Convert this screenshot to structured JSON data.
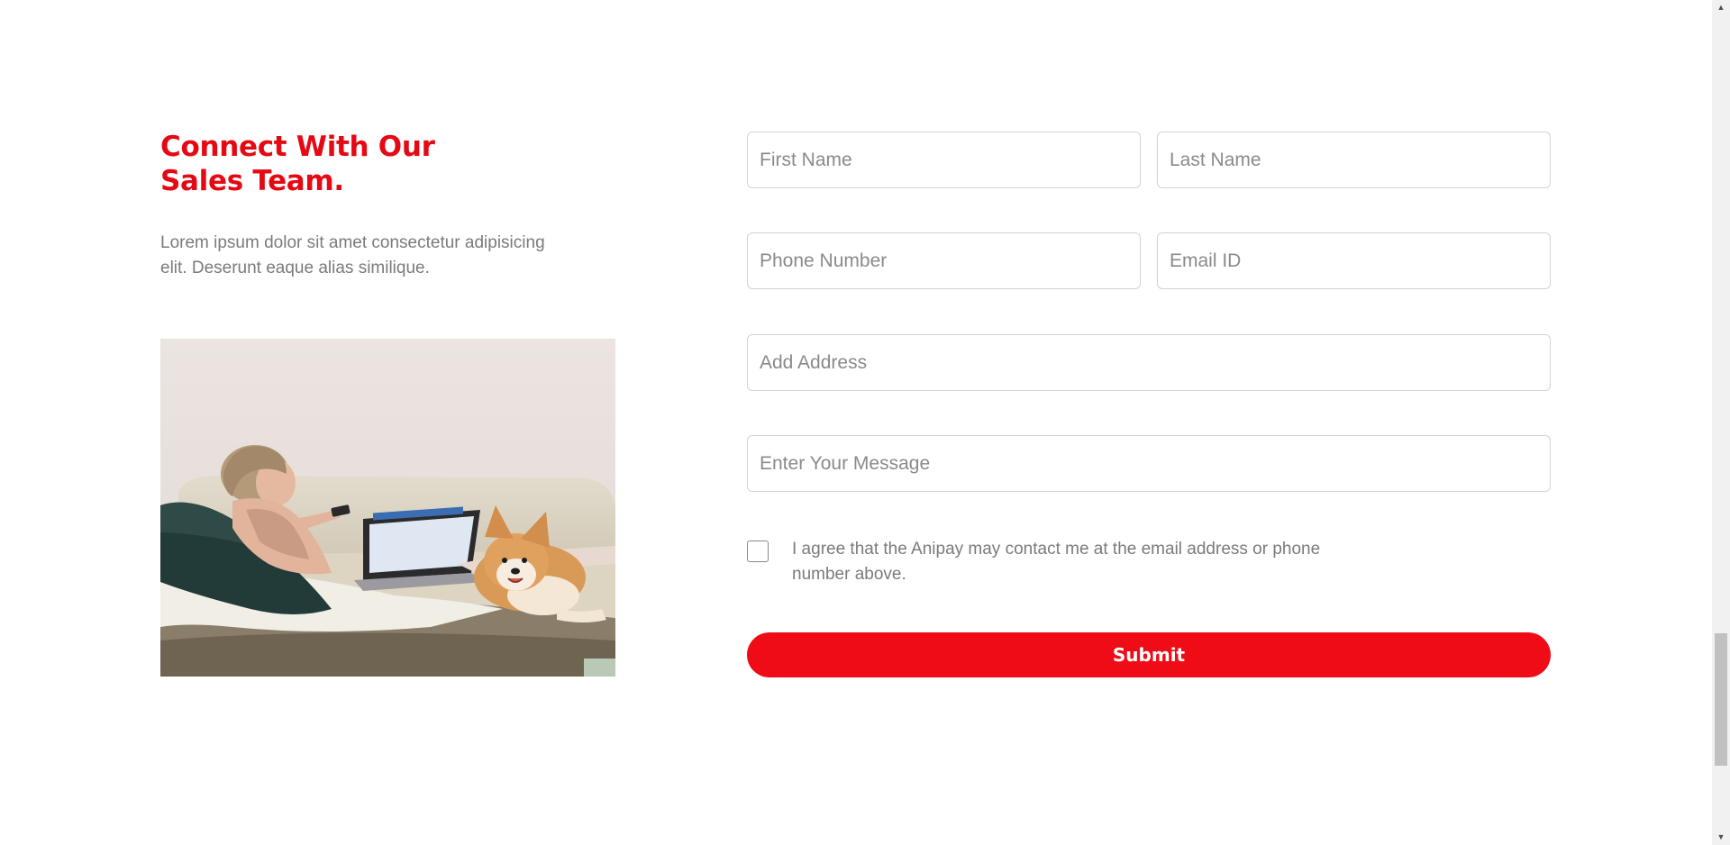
{
  "section": {
    "heading_line1": "Connect With Our",
    "heading_line2": "Sales Team.",
    "intro": "Lorem ipsum dolor sit amet consectetur adipisicing elit. Deserunt eaque alias similique."
  },
  "form": {
    "first_name_placeholder": "First Name",
    "last_name_placeholder": "Last Name",
    "phone_placeholder": "Phone Number",
    "email_placeholder": "Email ID",
    "address_placeholder": "Add Address",
    "message_placeholder": "Enter Your Message",
    "consent_text": "I agree that the Anipay may contact me at the email address or phone number above.",
    "consent_checked": false,
    "submit_label": "Submit"
  },
  "colors": {
    "accent": "#e50914",
    "button": "#ef0c16",
    "body_text": "#7b7b7b",
    "field_border": "#d3d3d3"
  },
  "icons": {
    "scroll_up": "chevron-up-icon",
    "scroll_down": "chevron-down-icon"
  }
}
